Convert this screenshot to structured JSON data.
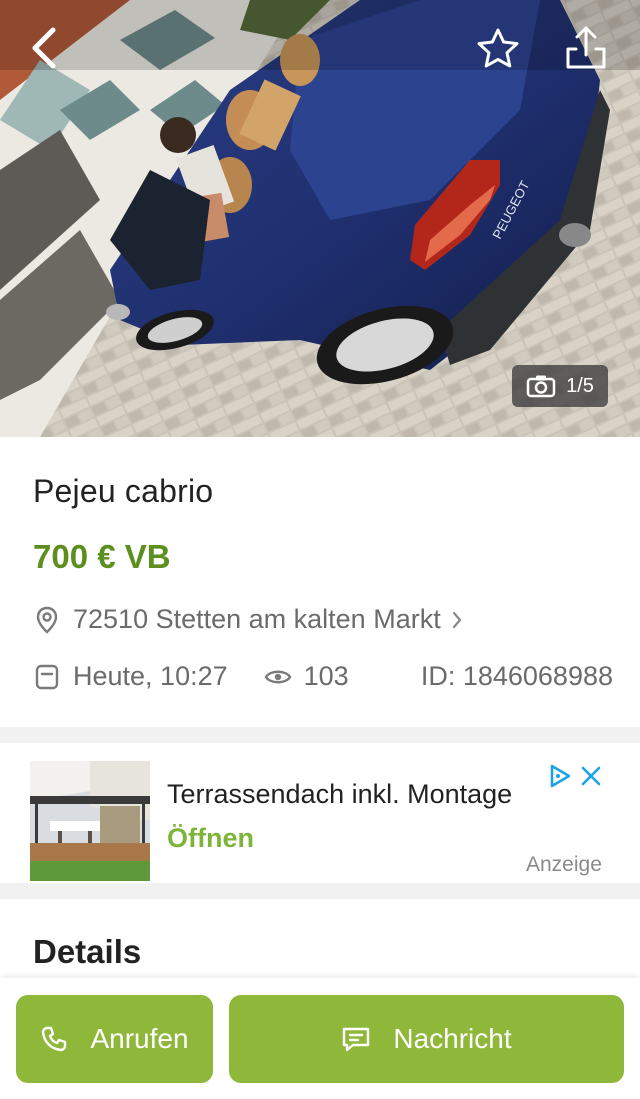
{
  "photo": {
    "counter": "1/5",
    "alt": "Photo of a blue Peugeot cabriolet",
    "car_brand_lettering": "PEUGEOT"
  },
  "nav": {
    "back_icon": "chevron-left-icon",
    "favorite_icon": "star-outline-icon",
    "share_icon": "share-icon"
  },
  "listing": {
    "title": "Pejeu cabrio",
    "price": "700 € VB",
    "location": "72510 Stetten am kalten Markt",
    "date": "Heute, 10:27",
    "views": "103",
    "id": "ID: 1846068988"
  },
  "ad": {
    "title": "Terrassendach inkl. Montage",
    "cta": "Öffnen",
    "label": "Anzeige"
  },
  "sections": {
    "details": "Details"
  },
  "actions": {
    "call": "Anrufen",
    "message": "Nachricht"
  },
  "colors": {
    "price_green": "#5d8f1e",
    "button_green": "#8fb83a",
    "link_green": "#7fb43a",
    "adchoice_blue": "#1aa3e8"
  }
}
